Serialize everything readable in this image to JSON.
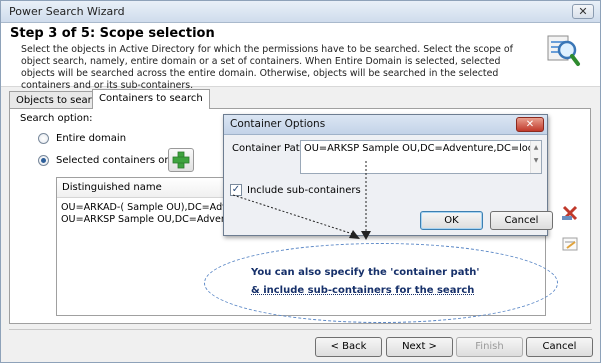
{
  "window": {
    "title": "Power Search Wizard",
    "close_glyph": "✕"
  },
  "header": {
    "step_title": "Step 3 of 5:  Scope selection",
    "description": "Select the objects in Active Directory for which the permissions have to be searched. Select the scope of object search, namely, entire domain or a set of containers. When Entire Domain is selected, selected objects will be searched across the entire domain. Otherwise, objects will be searched in the selected containers and or its sub-containers.",
    "icon": "search-magnifier-icon"
  },
  "tabs": [
    {
      "label": "Objects to search",
      "active": false
    },
    {
      "label": "Containers to search",
      "active": true
    }
  ],
  "search_option": {
    "label": "Search option:",
    "options": [
      {
        "label": "Entire domain",
        "checked": false
      },
      {
        "label": "Selected containers only",
        "checked": true
      }
    ],
    "add_icon": "plus-icon"
  },
  "containers_list": {
    "column_header": "Distinguished name",
    "rows": [
      "OU=ARKAD-( Sample OU),DC=Adve...",
      "OU=ARKSP Sample OU,DC=Advent..."
    ],
    "side_icons": [
      "delete-icon",
      "edit-icon"
    ]
  },
  "dialog": {
    "title": "Container Options",
    "close_glyph": "✕",
    "path_label": "Container Path:",
    "path_value": "OU=ARKSP Sample OU,DC=Adventure,DC=local",
    "include_sub_label": "Include sub-containers",
    "include_sub_checked": true,
    "ok_label": "OK",
    "cancel_label": "Cancel"
  },
  "callout": {
    "line1": "You can also specify the 'container path'",
    "line2": "& include sub-containers for the search"
  },
  "footer": {
    "back_label": "< Back",
    "next_label": "Next >",
    "finish_label": "Finish",
    "cancel_label": "Cancel"
  },
  "colors": {
    "accent_blue": "#2d5f9a",
    "callout_text": "#16306a",
    "dialog_close": "#c0392b"
  }
}
